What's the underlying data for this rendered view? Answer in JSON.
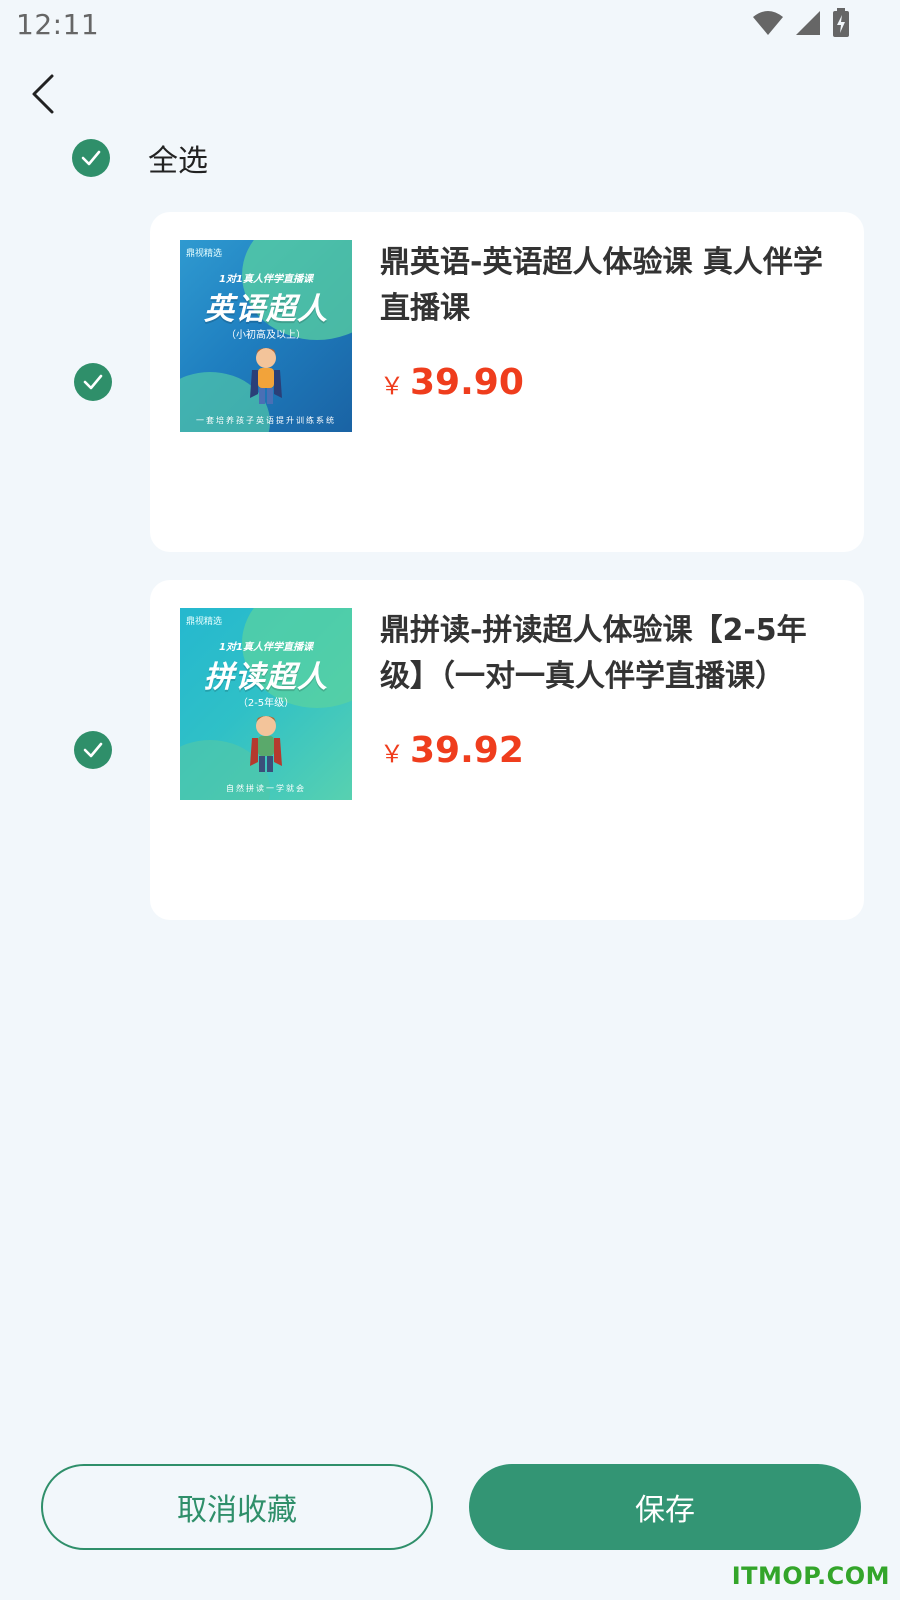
{
  "status_bar": {
    "time": "12:11",
    "icons": [
      "wifi-icon",
      "signal-icon",
      "battery-icon"
    ]
  },
  "nav": {
    "back_icon": "chevron-left-icon"
  },
  "select_all": {
    "label": "全选",
    "checked": true
  },
  "courses": [
    {
      "title": "鼎英语-英语超人体验课 真人伴学直播课",
      "currency": "￥",
      "price": "39.90",
      "checked": true,
      "thumbnail": {
        "brand": "鼎视精选",
        "tagline": "1对1真人伴学直播课",
        "big_text": "英语超人",
        "subtitle": "（小初高及以上）",
        "footer": "一套培养孩子英语提升训练系统"
      }
    },
    {
      "title": "鼎拼读-拼读超人体验课【2-5年级】（一对一真人伴学直播课）",
      "currency": "￥",
      "price": "39.92",
      "checked": true,
      "thumbnail": {
        "brand": "鼎视精选",
        "tagline": "1对1真人伴学直播课",
        "big_text": "拼读超人",
        "subtitle": "（2-5年级）",
        "footer": "自然拼读一学就会"
      }
    }
  ],
  "actions": {
    "cancel_label": "取消收藏",
    "save_label": "保存"
  },
  "watermark": "ITMOP.COM",
  "colors": {
    "background": "#f2f7fb",
    "accent": "#339574",
    "price": "#ef3d1d",
    "watermark": "#33a52a"
  }
}
